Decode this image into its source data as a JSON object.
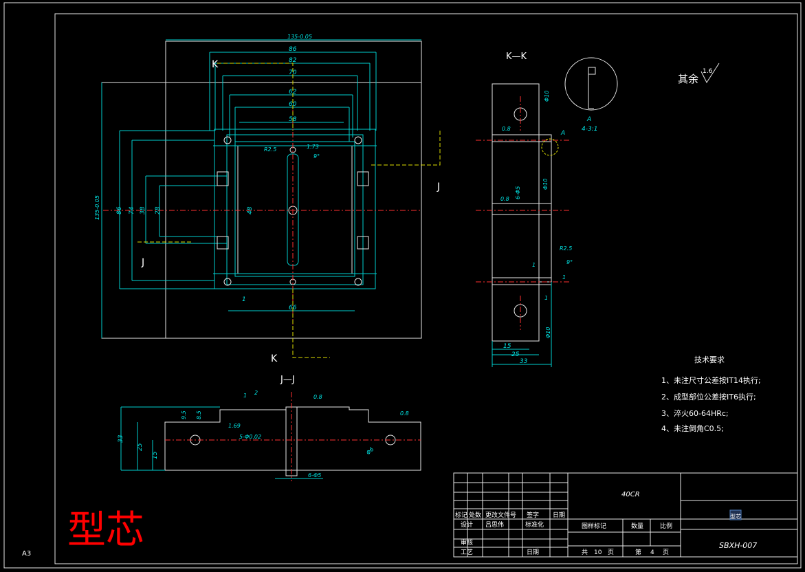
{
  "sheet": {
    "size": "A3",
    "big_title": "型芯",
    "roughness_note": "其余",
    "roughness_value": "1.6"
  },
  "views": {
    "section_kk": "K—K",
    "section_jj": "J—J",
    "cut_k": "K",
    "cut_j": "J",
    "detail_a": "A",
    "detail_a_scale": "4-3:1"
  },
  "dims_top": [
    "135-0.05",
    "86",
    "82",
    "70",
    "62",
    "60",
    "58",
    "66",
    "1"
  ],
  "dims_left": [
    "135-0.05",
    "86",
    "74",
    "38",
    "28",
    "48"
  ],
  "dims_small": [
    "R2.5",
    "1.73",
    "9°",
    "R2.5",
    "9°",
    "1",
    "1",
    "1",
    "15",
    "25",
    "33",
    "6-Φ5",
    "0.8",
    "0.8",
    "Φ10",
    "Φ10",
    "Φ10"
  ],
  "dims_jj": [
    "33",
    "25",
    "15",
    "9.5",
    "8.5",
    "1.69",
    "5-Φ0.02",
    "1",
    "2",
    "Φ6",
    "6-Φ5",
    "0.8",
    "0.8"
  ],
  "tech": {
    "title": "技术要求",
    "items": [
      "1、未注尺寸公差按IT14执行;",
      "2、成型部位公差按IT6执行;",
      "3、淬火60-64HRc;",
      "4、未注倒角C0.5;"
    ]
  },
  "title_block": {
    "material": "40CR",
    "drawing_no": "SBXH-007",
    "part_name": "型芯",
    "row_headers": [
      "标记",
      "处数",
      "更改文件号",
      "签字",
      "日期"
    ],
    "design": "设计",
    "designer": "吕思伟",
    "standard": "标准化",
    "review": "审核",
    "process": "工艺",
    "date": "日期",
    "stage": "图样标记",
    "qty": "数量",
    "scale": "比例",
    "total": "共",
    "total_n": "10",
    "page_unit": "页",
    "sheet": "第",
    "sheet_n": "4",
    "page_unit2": "页"
  },
  "colors": {
    "frame": "#e8e8e8",
    "dim": "#00e6e6",
    "center": "#ff3030",
    "hatch": "#00c000",
    "title": "#ff0000"
  }
}
